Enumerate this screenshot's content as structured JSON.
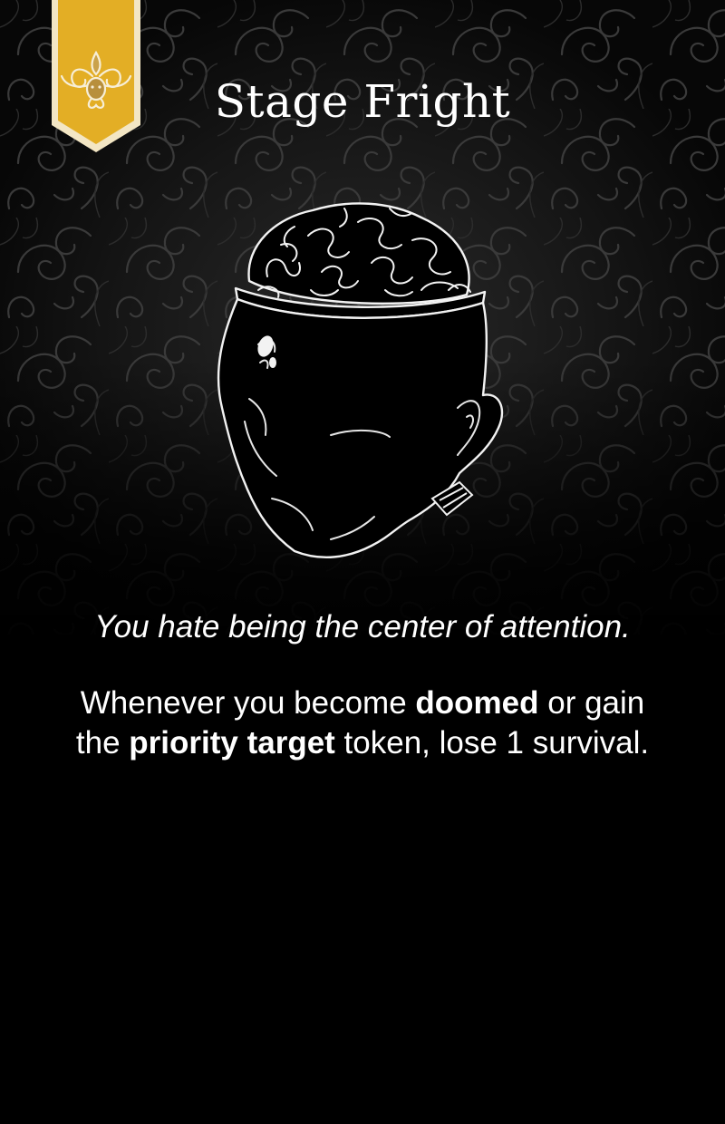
{
  "card": {
    "title": "Stage Fright",
    "banner_icon": "ornate-crest-icon",
    "art_icon": "open-skull-brain-head-icon",
    "flavor_text": "You hate being the center of attention.",
    "rules": {
      "part1": "Whenever you become ",
      "keyword1": "doomed",
      "part2": " or gain the ",
      "keyword2": "priority target",
      "part3": " token, lose 1 survival."
    }
  },
  "colors": {
    "background": "#000000",
    "banner_gold": "#E3AE25",
    "banner_border": "#F3E6C4",
    "text": "#FFFFFF"
  }
}
